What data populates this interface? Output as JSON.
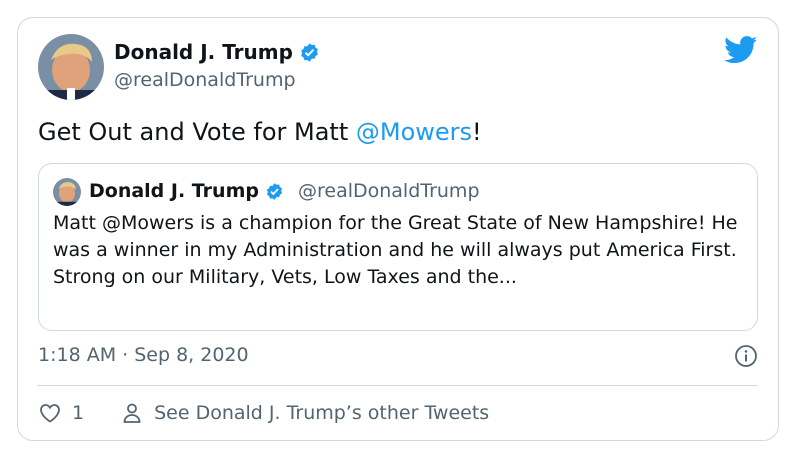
{
  "author": {
    "name": "Donald J. Trump",
    "handle": "@realDonaldTrump",
    "avatar_icon": "profile-photo",
    "verified_icon": "verified-badge-icon"
  },
  "tweet": {
    "text_before": "Get Out and Vote for Matt ",
    "mention": "@Mowers",
    "text_after": "!"
  },
  "quoted_tweet": {
    "name": "Donald J. Trump",
    "handle": "@realDonaldTrump",
    "text": "Matt @Mowers is a champion for the Great State of New Hampshire! He was a winner in my Administration and he will always put America First. Strong on our Military, Vets, Low Taxes and the..."
  },
  "timestamp": "1:18 AM · Sep 8, 2020",
  "actions": {
    "like_count": "1",
    "profile_link": "See Donald J. Trump’s other Tweets"
  },
  "colors": {
    "accent": "#1d9bf0",
    "secondary_text": "#536471",
    "border": "#cfd9de"
  }
}
